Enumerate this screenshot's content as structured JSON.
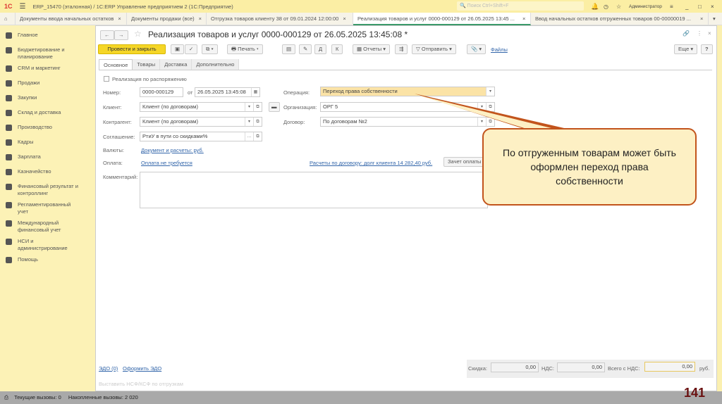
{
  "app": {
    "title": "ERP_15470 (эталонная) / 1С:ERP Управление предприятием 2  (1С:Предприятие)",
    "search_placeholder": "Поиск Ctrl+Shift+F",
    "user": "Администратор"
  },
  "tabs": [
    {
      "label": "Документы ввода начальных остатков"
    },
    {
      "label": "Документы продажи (все)"
    },
    {
      "label": "Отгрузка товаров клиенту 38 от 09.01.2024 12:00:00"
    },
    {
      "label": "Реализация товаров и услуг 0000-000129 от 26.05.2025 13:45 ..."
    },
    {
      "label": "Ввод начальных остатков отгруженных товаров 00-00000019 ..."
    }
  ],
  "sidebar": {
    "items": [
      {
        "label": "Главное"
      },
      {
        "label": "Бюджетирование и планирование"
      },
      {
        "label": "CRM и маркетинг"
      },
      {
        "label": "Продажи"
      },
      {
        "label": "Закупки"
      },
      {
        "label": "Склад и доставка"
      },
      {
        "label": "Производство"
      },
      {
        "label": "Кадры"
      },
      {
        "label": "Зарплата"
      },
      {
        "label": "Казначейство"
      },
      {
        "label": "Финансовый результат и контроллинг"
      },
      {
        "label": "Регламентированный учет"
      },
      {
        "label": "Международный финансовый учет"
      },
      {
        "label": "НСИ и администрирование"
      },
      {
        "label": "Помощь"
      }
    ]
  },
  "doc": {
    "title": "Реализация товаров и услуг 0000-000129 от 26.05.2025 13:45:08 *"
  },
  "toolbar": {
    "post_close": "Провести и закрыть",
    "print": "Печать",
    "reports": "Отчеты",
    "send": "Отправить",
    "files": "Файлы",
    "more": "Еще",
    "help": "?"
  },
  "form_tabs": [
    "Основное",
    "Товары",
    "Доставка",
    "Дополнительно"
  ],
  "form": {
    "by_order": "Реализация по распоряжению",
    "number_label": "Номер:",
    "number": "0000-000129",
    "from_label": "от",
    "date": "26.05.2025 13:45:08",
    "client_label": "Клиент:",
    "client": "Клиент (по договорам)",
    "counterparty_label": "Контрагент:",
    "counterparty": "Клиент (по договорам)",
    "agreement_label": "Соглашение:",
    "agreement": "РтиУ в пути со скидками%",
    "currency_label": "Валюты:",
    "currency_link": "Документ и расчеты: руб.",
    "payment_label": "Оплата:",
    "payment_link": "Оплата не требуется",
    "comment_label": "Комментарий:",
    "operation_label": "Операция:",
    "operation": "Переход права собственности",
    "org_label": "Организация:",
    "org": "ОРГ 5",
    "contract_label": "Договор:",
    "contract": "По договорам №2",
    "settlements_link": "Расчеты по договору: долг клиента 14 282,40 руб.",
    "offset_btn": "Зачет оплаты"
  },
  "footer": {
    "edo": "ЭДО (0)",
    "make_edo": "Оформить ЭДО",
    "invoice_hint": "Выставить НСФ/КСФ по отгрузкам",
    "discount_label": "Скидка:",
    "discount": "0,00",
    "vat_label": "НДС:",
    "vat": "0,00",
    "total_label": "Всего с НДС:",
    "total": "0,00",
    "currency": "руб."
  },
  "status": {
    "current": "Текущие вызовы: 0",
    "accumulated": "Накопленные вызовы: 2 020"
  },
  "callout": "По отгруженным товарам может быть оформлен переход права собственности",
  "page_number": "141"
}
